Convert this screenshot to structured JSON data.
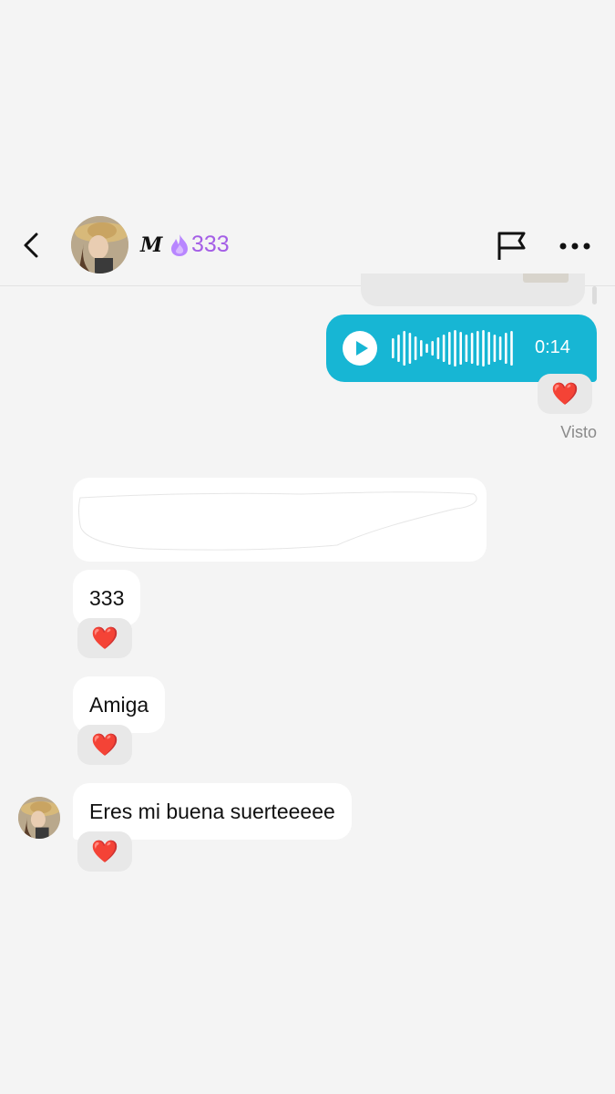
{
  "header": {
    "contact_name": "M",
    "streak_count": "333",
    "icons": [
      "chevron-left-icon",
      "flame-icon",
      "flag-icon",
      "more-horizontal-icon"
    ]
  },
  "messages": {
    "voice": {
      "duration": "0:14",
      "reaction": "❤️"
    },
    "seen_label": "Visto",
    "incoming": [
      {
        "text": "333",
        "reaction": "❤️"
      },
      {
        "text": "Amiga",
        "reaction": "❤️"
      },
      {
        "text": "Eres mi buena suerteeeee",
        "reaction": "❤️"
      }
    ]
  },
  "colors": {
    "background": "#f4f4f4",
    "outgoing_bubble": "#17b6d4",
    "incoming_bubble": "#ffffff",
    "streak": "#a45ee6",
    "reaction_bg": "#e8e8e8"
  }
}
